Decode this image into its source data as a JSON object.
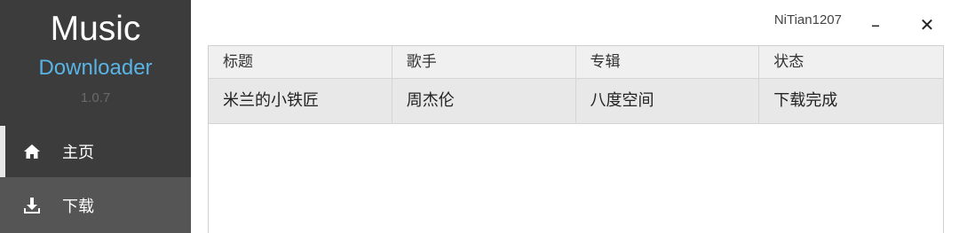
{
  "sidebar": {
    "app_name": "Music",
    "app_subtitle": "Downloader",
    "version": "1.0.7",
    "nav": [
      {
        "label": "主页",
        "icon": "home-icon"
      },
      {
        "label": "下载",
        "icon": "download-icon"
      }
    ],
    "colors": {
      "background": "#3c3c3c",
      "active": "#555555",
      "accent": "#59b4e6"
    }
  },
  "topbar": {
    "username": "NiTian1207",
    "minimize_label": "–",
    "close_label": "✕"
  },
  "table": {
    "columns": [
      "标题",
      "歌手",
      "专辑",
      "状态"
    ],
    "rows": [
      [
        "米兰的小铁匠",
        "周杰伦",
        "八度空间",
        "下载完成"
      ]
    ]
  }
}
